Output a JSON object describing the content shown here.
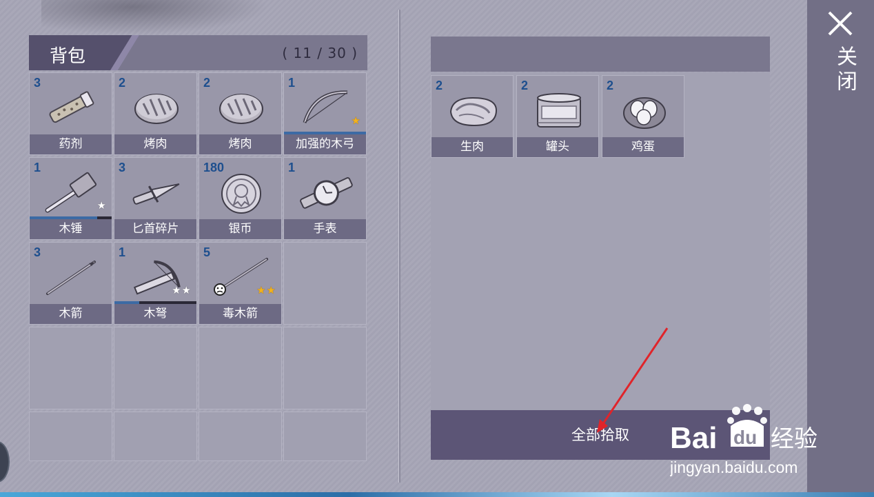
{
  "inventory": {
    "title": "背包",
    "capacity": "( 11 / 30 )",
    "items": [
      {
        "qty": "3",
        "name": "药剂",
        "icon": "potion-icon"
      },
      {
        "qty": "2",
        "name": "烤肉",
        "icon": "roasted-meat-icon"
      },
      {
        "qty": "2",
        "name": "烤肉",
        "icon": "roasted-meat-icon"
      },
      {
        "qty": "1",
        "name": "加强的木弓",
        "icon": "bow-icon",
        "durability": 1.0,
        "stars": 1,
        "star_color": "gold"
      },
      {
        "qty": "1",
        "name": "木锤",
        "icon": "hammer-icon",
        "durability": 0.82,
        "stars": 1,
        "star_color": "white"
      },
      {
        "qty": "3",
        "name": "匕首碎片",
        "icon": "dagger-fragment-icon"
      },
      {
        "qty": "180",
        "name": "银币",
        "icon": "silver-coin-icon"
      },
      {
        "qty": "1",
        "name": "手表",
        "icon": "watch-icon"
      },
      {
        "qty": "3",
        "name": "木箭",
        "icon": "wooden-arrow-icon"
      },
      {
        "qty": "1",
        "name": "木弩",
        "icon": "crossbow-icon",
        "durability": 0.3,
        "stars": 2,
        "star_color": "white"
      },
      {
        "qty": "5",
        "name": "毒木箭",
        "icon": "poison-arrow-icon",
        "stars": 2,
        "star_color": "gold"
      }
    ]
  },
  "loot": {
    "items": [
      {
        "qty": "2",
        "name": "生肉",
        "icon": "raw-meat-icon"
      },
      {
        "qty": "2",
        "name": "罐头",
        "icon": "canned-food-icon"
      },
      {
        "qty": "2",
        "name": "鸡蛋",
        "icon": "eggs-icon"
      }
    ],
    "pickup_all_label": "全部拾取"
  },
  "close": {
    "label": "关闭"
  },
  "watermark": {
    "brand": "Bai",
    "brand2": "du",
    "cn": "经验",
    "url": "jingyan.baidu.com"
  },
  "colors": {
    "qty_blue": "#1e4f8e",
    "panel_dark": "#55506c",
    "button": "#5c5576",
    "arrow_red": "#e0242a"
  }
}
